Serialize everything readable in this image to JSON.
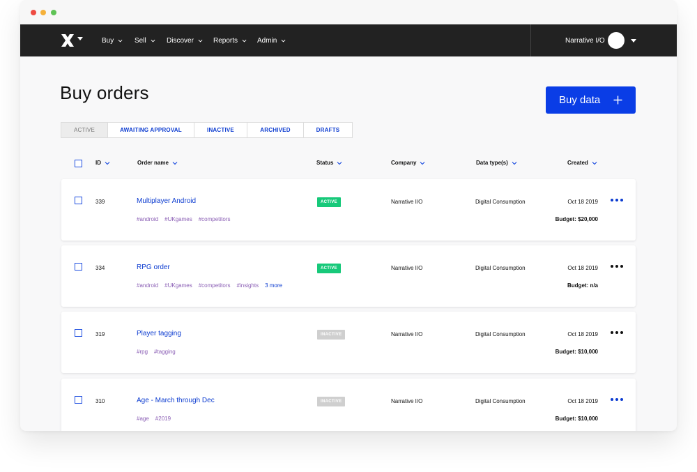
{
  "nav": {
    "items": [
      {
        "label": "Buy"
      },
      {
        "label": "Sell"
      },
      {
        "label": "Discover"
      },
      {
        "label": "Reports"
      },
      {
        "label": "Admin"
      }
    ],
    "org_name": "Narrative I/O"
  },
  "page": {
    "title": "Buy orders",
    "buy_button": "Buy data"
  },
  "tabs": [
    {
      "label": "ACTIVE",
      "selected": true
    },
    {
      "label": "AWAITING APPROVAL",
      "selected": false
    },
    {
      "label": "INACTIVE",
      "selected": false
    },
    {
      "label": "ARCHIVED",
      "selected": false
    },
    {
      "label": "DRAFTS",
      "selected": false
    }
  ],
  "table": {
    "headers": {
      "id": "ID",
      "order_name": "Order name",
      "status": "Status",
      "company": "Company",
      "data_types": "Data type(s)",
      "created": "Created"
    },
    "rows": [
      {
        "id": "339",
        "name": "Multiplayer Android",
        "tags": [
          "#android",
          "#UKgames",
          "#competitors"
        ],
        "more_tags": "",
        "status": "ACTIVE",
        "company": "Narrative I/O",
        "data_type": "Digital Consumption",
        "created": "Oct 18 2019",
        "budget": "Budget: $20,000"
      },
      {
        "id": "334",
        "name": "RPG order",
        "tags": [
          "#android",
          "#UKgames",
          "#competitors",
          "#insights"
        ],
        "more_tags": "3 more",
        "status": "ACTIVE",
        "company": "Narrative I/O",
        "data_type": "Digital Consumption",
        "created": "Oct 18 2019",
        "budget": "Budget: n/a"
      },
      {
        "id": "319",
        "name": "Player tagging",
        "tags": [
          "#rpg",
          "#tagging"
        ],
        "more_tags": "",
        "status": "INACTIVE",
        "company": "Narrative I/O",
        "data_type": "Digital Consumption",
        "created": "Oct 18 2019",
        "budget": "Budget: $10,000"
      },
      {
        "id": "310",
        "name": "Age - March through Dec",
        "tags": [
          "#age",
          "#2019"
        ],
        "more_tags": "",
        "status": "INACTIVE",
        "company": "Narrative I/O",
        "data_type": "Digital Consumption",
        "created": "Oct 18 2019",
        "budget": "Budget: $10,000"
      }
    ]
  },
  "colors": {
    "navbar": "#222222",
    "accent": "#0a3de6",
    "status_active": "#17c97a",
    "status_inactive": "#cfcfcf",
    "tag": "#8b5fb5"
  },
  "icons": {
    "logo": "narrative-logo-icon",
    "chevron": "chevron-down-icon",
    "plus": "plus-icon",
    "more": "more-dots-icon"
  }
}
